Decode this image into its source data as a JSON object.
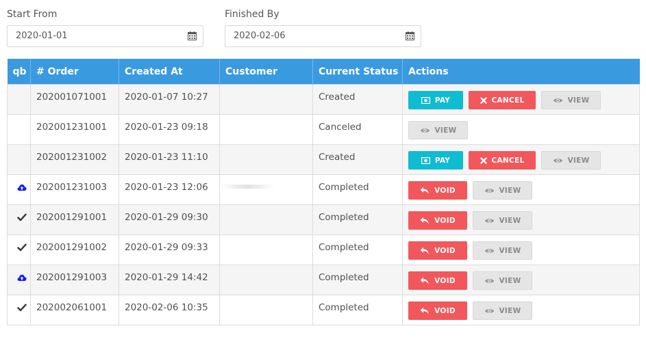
{
  "filters": {
    "start": {
      "label": "Start From",
      "value": "2020-01-01"
    },
    "finish": {
      "label": "Finished By",
      "value": "2020-02-06"
    }
  },
  "table": {
    "headers": [
      "qb",
      "# Order",
      "Created At",
      "Customer",
      "Current Status",
      "Actions"
    ],
    "rows": [
      {
        "qb": "none",
        "order": "202001071001",
        "created": "2020-01-07 10:27",
        "customer": "",
        "status": "Created",
        "actions": [
          "pay",
          "cancel",
          "view"
        ]
      },
      {
        "qb": "none",
        "order": "202001231001",
        "created": "2020-01-23 09:18",
        "customer": "",
        "status": "Canceled",
        "actions": [
          "view"
        ]
      },
      {
        "qb": "none",
        "order": "202001231002",
        "created": "2020-01-23 11:10",
        "customer": "",
        "status": "Created",
        "actions": [
          "pay",
          "cancel",
          "view"
        ]
      },
      {
        "qb": "cloud-upload-icon",
        "order": "202001231003",
        "created": "2020-01-23 12:06",
        "customer": "",
        "status": "Completed",
        "actions": [
          "void",
          "view"
        ]
      },
      {
        "qb": "check-icon",
        "order": "202001291001",
        "created": "2020-01-29 09:30",
        "customer": "",
        "status": "Completed",
        "actions": [
          "void",
          "view"
        ]
      },
      {
        "qb": "check-icon",
        "order": "202001291002",
        "created": "2020-01-29 09:33",
        "customer": "",
        "status": "Completed",
        "actions": [
          "void",
          "view"
        ]
      },
      {
        "qb": "cloud-upload-icon",
        "order": "202001291003",
        "created": "2020-01-29 14:42",
        "customer": "",
        "status": "Completed",
        "actions": [
          "void",
          "view"
        ]
      },
      {
        "qb": "check-icon",
        "order": "202002061001",
        "created": "2020-02-06 10:35",
        "customer": "",
        "status": "Completed",
        "actions": [
          "void",
          "view"
        ]
      }
    ]
  },
  "buttons": {
    "pay": "PAY",
    "cancel": "CANCEL",
    "view": "VIEW",
    "void": "VOID"
  },
  "icons": {
    "date_field": "calendar-icon"
  },
  "colors": {
    "header": "#3a9ae0",
    "pay": "#10bcd1",
    "danger": "#f2575b",
    "view": "#e5e5e5",
    "cloud": "#1a1aff"
  }
}
